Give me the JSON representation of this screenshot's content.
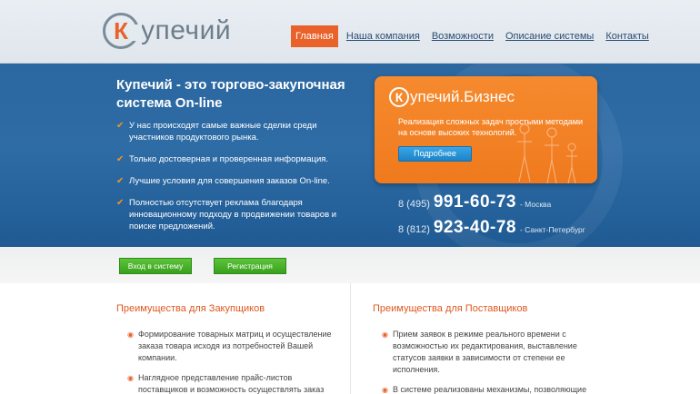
{
  "logo": {
    "letter": "К",
    "text": "упечий"
  },
  "nav": {
    "items": [
      {
        "label": "Главная",
        "active": true
      },
      {
        "label": "Наша компания",
        "active": false
      },
      {
        "label": "Возможности",
        "active": false
      },
      {
        "label": "Описание системы",
        "active": false
      },
      {
        "label": "Контакты",
        "active": false
      }
    ]
  },
  "hero": {
    "title": "Купечий - это торгово-закупочная система On-line",
    "features": [
      "У нас происходят самые важные сделки среди участников продуктового рынка.",
      "Только достоверная и проверенная информация.",
      "Лучшие условия для совершения заказов On-line.",
      "Полностью отсутствует реклама благодаря инновационному подходу в продвижении товаров и поиске предложений."
    ]
  },
  "promo": {
    "letter": "К",
    "title": "упечий.Бизнес",
    "text": "Реализация сложных задач простыми методами на основе высоких технологий.",
    "button_label": "Подробнее"
  },
  "phones": [
    {
      "code": "8 (495)",
      "number": "991-60-73",
      "city": "- Москва"
    },
    {
      "code": "8 (812)",
      "number": "923-40-78",
      "city": "- Санкт-Петербург"
    }
  ],
  "actions": {
    "login_label": "Вход в систему",
    "register_label": "Регистрация"
  },
  "buyers": {
    "title": "Преимущества для Закупщиков",
    "items": [
      "Формирование товарных матриц и осуществление заказа товара исходя из потребностей Вашей компании.",
      "Наглядное представление прайс-листов поставщиков и возможность осуществлять заказ"
    ]
  },
  "suppliers": {
    "title": "Преимущества для Поставщиков",
    "items": [
      "Прием заявок в режиме реального времени с возможностью их редактирования, выставление статусов заявки в зависимости от степени ее исполнения.",
      "В системе реализованы механизмы, позволяющие"
    ]
  },
  "colors": {
    "accent": "#e8622a",
    "header_blue": "#2e6ca6",
    "green": "#3aa11e"
  },
  "icons": {
    "check": "✔",
    "bullet": "◉"
  }
}
